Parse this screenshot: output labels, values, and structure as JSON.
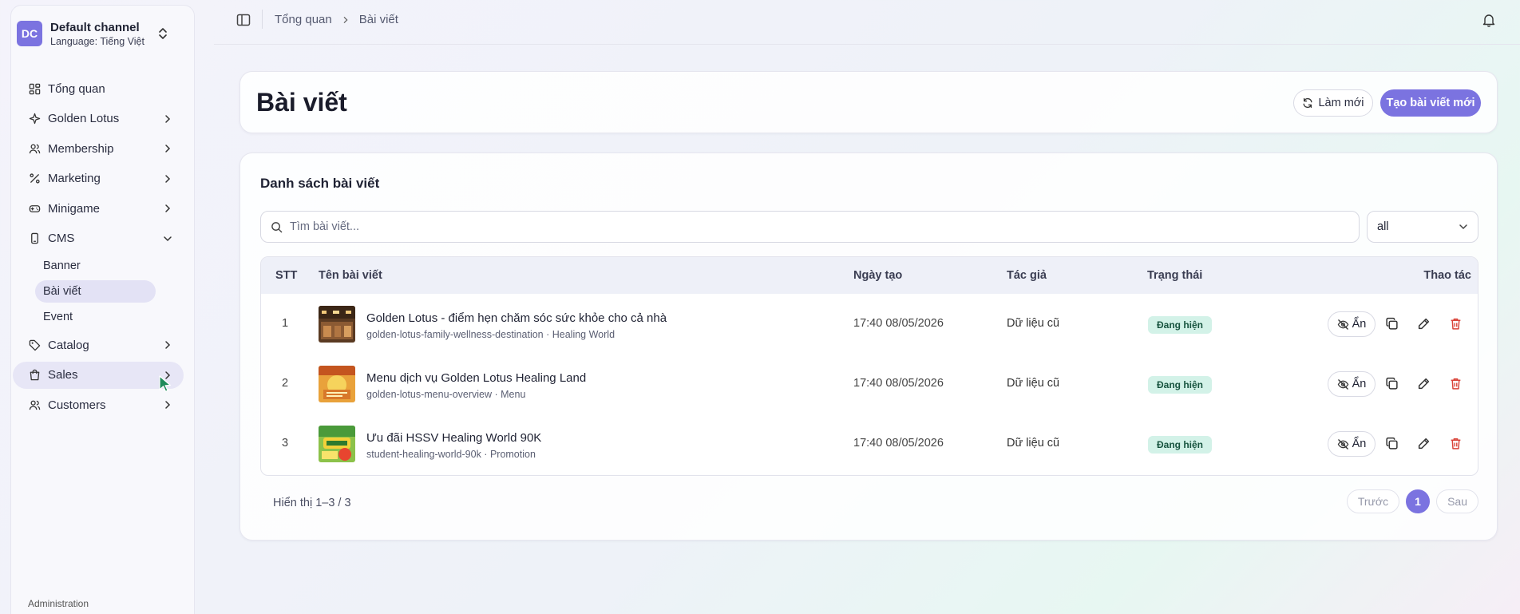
{
  "channel": {
    "initials": "DC",
    "name": "Default channel",
    "language": "Language: Tiếng Việt"
  },
  "nav": {
    "items": [
      {
        "label": "Tổng quan",
        "icon": "dashboard-icon"
      },
      {
        "label": "Golden Lotus",
        "icon": "sparkle-icon"
      },
      {
        "label": "Membership",
        "icon": "users-icon"
      },
      {
        "label": "Marketing",
        "icon": "percent-icon"
      },
      {
        "label": "Minigame",
        "icon": "gamepad-icon"
      },
      {
        "label": "CMS",
        "icon": "phone-icon"
      },
      {
        "label": "Catalog",
        "icon": "tag-icon"
      },
      {
        "label": "Sales",
        "icon": "shopping-bag-icon"
      },
      {
        "label": "Customers",
        "icon": "users-icon"
      }
    ],
    "cms_sub": [
      "Banner",
      "Bài viết",
      "Event"
    ],
    "admin_label": "Administration"
  },
  "breadcrumb": {
    "root": "Tổng quan",
    "current": "Bài viết"
  },
  "header": {
    "title": "Bài viết",
    "refresh_label": "Làm mới",
    "create_label": "Tạo bài viết mới"
  },
  "list": {
    "title": "Danh sách bài viết",
    "search_placeholder": "Tìm bài viết...",
    "filter_value": "all",
    "columns": {
      "stt": "STT",
      "name": "Tên bài viết",
      "date": "Ngày tạo",
      "author": "Tác giả",
      "status": "Trạng thái",
      "actions": "Thao tác"
    },
    "rows": [
      {
        "stt": "1",
        "title": "Golden Lotus - điểm hẹn chăm sóc sức khỏe cho cả nhà",
        "slug": "golden-lotus-family-wellness-destination · Healing World",
        "date": "17:40 08/05/2026",
        "author": "Dữ liệu cũ",
        "status": "Đang hiện",
        "hide_label": "Ẩn"
      },
      {
        "stt": "2",
        "title": "Menu dịch vụ Golden Lotus Healing Land",
        "slug": "golden-lotus-menu-overview · Menu",
        "date": "17:40 08/05/2026",
        "author": "Dữ liệu cũ",
        "status": "Đang hiện",
        "hide_label": "Ẩn"
      },
      {
        "stt": "3",
        "title": "Ưu đãi HSSV Healing World 90K",
        "slug": "student-healing-world-90k · Promotion",
        "date": "17:40 08/05/2026",
        "author": "Dữ liệu cũ",
        "status": "Đang hiện",
        "hide_label": "Ẩn"
      }
    ],
    "footer_text": "Hiển thị 1–3 / 3",
    "pager": {
      "prev": "Trước",
      "current": "1",
      "next": "Sau"
    }
  },
  "colors": {
    "accent": "#7b73e0",
    "badge_bg": "#d3f2e8",
    "badge_text": "#17543f",
    "delete": "#d9443a"
  }
}
